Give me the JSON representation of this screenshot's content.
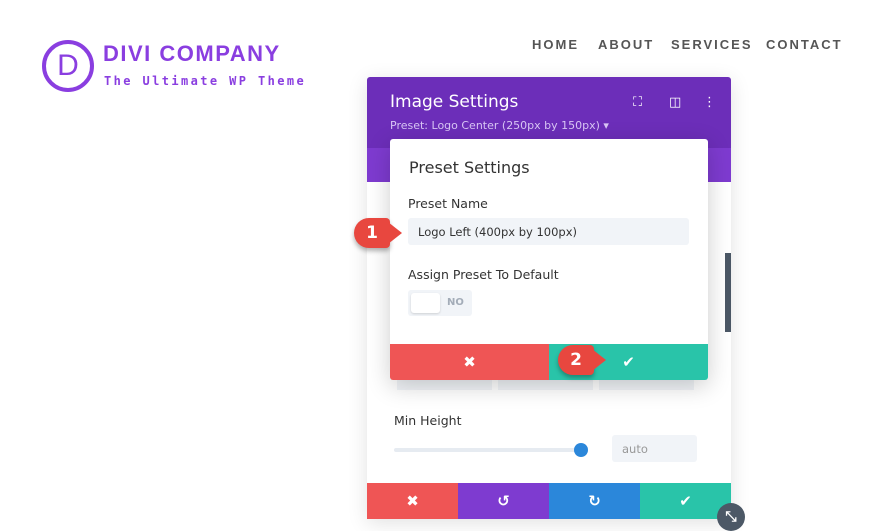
{
  "brand": {
    "logo_letter": "D",
    "name": "DIVI COMPANY",
    "tagline": "The Ultimate WP Theme",
    "color": "#8a3ee0"
  },
  "nav": [
    "HOME",
    "ABOUT",
    "SERVICES",
    "CONTACT"
  ],
  "modal": {
    "title": "Image Settings",
    "preset": "Preset: Logo Center (250px by 150px) ▾",
    "icons": [
      "fullscreen-icon",
      "split-view-icon",
      "more-options-icon"
    ]
  },
  "popup": {
    "title": "Preset Settings",
    "name_label": "Preset Name",
    "name_value": "Logo Left (400px by 100px)",
    "assign_label": "Assign Preset To Default",
    "toggle_value": "NO",
    "cancel": "✖",
    "confirm": "✔"
  },
  "min_height": {
    "label": "Min Height",
    "value": "auto",
    "slider_fraction": 1.0
  },
  "footer": {
    "cancel": "✖",
    "undo": "↺",
    "redo": "↻",
    "save": "✔"
  },
  "callouts": [
    "1",
    "2"
  ],
  "colors": {
    "header": "#6c2eb9",
    "red": "#ef5555",
    "purple": "#7e3bd0",
    "blue": "#2b87da",
    "green": "#29c4a9"
  }
}
